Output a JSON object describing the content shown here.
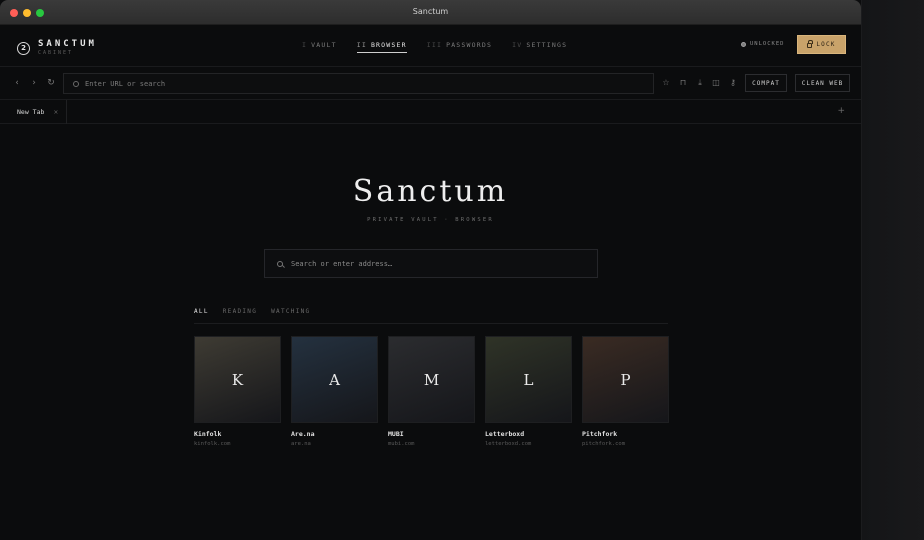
{
  "window": {
    "title": "Sanctum"
  },
  "brand": {
    "mark": "2",
    "name": "SANCTUM",
    "sub": "CABINET"
  },
  "nav": [
    {
      "num": "I",
      "label": "VAULT",
      "active": false
    },
    {
      "num": "II",
      "label": "BROWSER",
      "active": true
    },
    {
      "num": "III",
      "label": "PASSWORDS",
      "active": false
    },
    {
      "num": "IV",
      "label": "SETTINGS",
      "active": false
    }
  ],
  "status": {
    "label": "UNLOCKED"
  },
  "lock_button": {
    "label": "LOCK"
  },
  "toolbar": {
    "back_icon": "‹",
    "forward_icon": "›",
    "reload_icon": "↻",
    "url_placeholder": "Enter URL or search",
    "compat_label": "COMPAT",
    "clean_web_label": "CLEAN WEB"
  },
  "tabs": [
    {
      "label": "New Tab",
      "close": "×"
    }
  ],
  "new_tab_icon": "+",
  "hero": {
    "title": "Sanctum",
    "subtitle": "PRIVATE VAULT · BROWSER",
    "search_placeholder": "Search or enter address…"
  },
  "filters": [
    {
      "label": "ALL",
      "active": true
    },
    {
      "label": "READING",
      "active": false
    },
    {
      "label": "WATCHING",
      "active": false
    }
  ],
  "sites": [
    {
      "letter": "K",
      "name": "Kinfolk",
      "url": "kinfolk.com",
      "color": "#3e3b33"
    },
    {
      "letter": "A",
      "name": "Are.na",
      "url": "are.na",
      "color": "#24313f"
    },
    {
      "letter": "M",
      "name": "MUBI",
      "url": "mubi.com",
      "color": "#2b2c2f"
    },
    {
      "letter": "L",
      "name": "Letterboxd",
      "url": "letterboxd.com",
      "color": "#2f3327"
    },
    {
      "letter": "P",
      "name": "Pitchfork",
      "url": "pitchfork.com",
      "color": "#3a2b23"
    }
  ],
  "colors": {
    "accent": "#c9a36a",
    "background": "#0b0c0d"
  }
}
